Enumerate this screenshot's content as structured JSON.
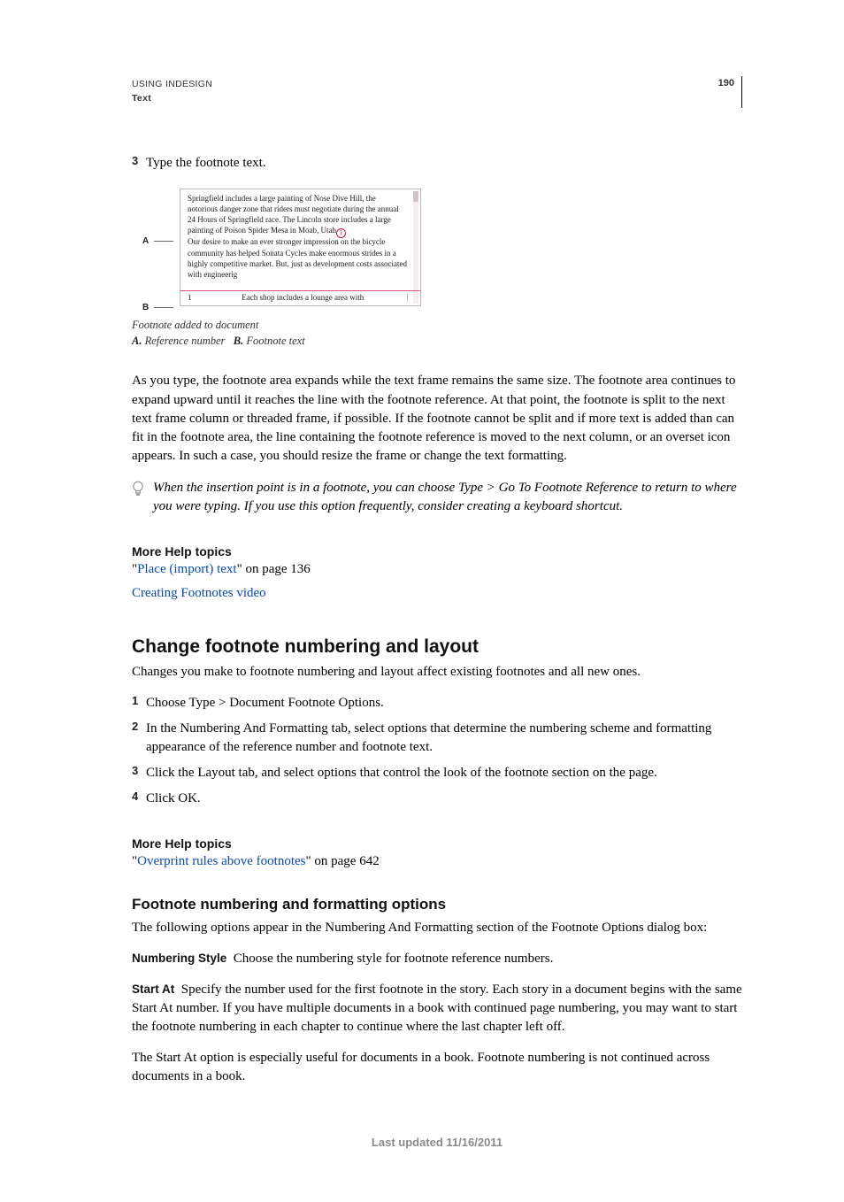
{
  "header": {
    "line1": "USING INDESIGN",
    "line2": "Text",
    "page_number": "190"
  },
  "step3": {
    "num": "3",
    "text": "Type the footnote text."
  },
  "figure": {
    "label_a": "A",
    "label_b": "B",
    "para1": "Springfield includes a large painting of Nose Dive Hill, the notorious danger zone that riders must negotiate during the annual 24 Hours of Springfield race. The Lincoln store includes a large painting of Poison Spider Mesa in Moab, Utah",
    "cursor_sup": "1",
    "para2": "Our desire to make an ever stronger impression on the bicycle community has helped Sonata Cycles make enormous strides in a highly competitive market. But, just as development costs associated with engineerig",
    "foot_num": "1",
    "foot_text": "Each shop includes a lounge area with",
    "caption_line1": "Footnote added to document",
    "caption_a_label": "A.",
    "caption_a_text": "Reference number",
    "caption_b_label": "B.",
    "caption_b_text": "Footnote text"
  },
  "body_para1": "As you type, the footnote area expands while the text frame remains the same size. The footnote area continues to expand upward until it reaches the line with the footnote reference. At that point, the footnote is split to the next text frame column or threaded frame, if possible. If the footnote cannot be split and if more text is added than can fit in the footnote area, the line containing the footnote reference is moved to the next column, or an overset icon appears. In such a case, you should resize the frame or change the text formatting.",
  "tip": "When the insertion point is in a footnote, you can choose Type > Go To Footnote Reference to return to where you were typing. If you use this option frequently, consider creating a keyboard shortcut.",
  "more_help_1": {
    "title": "More Help topics",
    "link1_text": "Place (import) text",
    "link1_suffix": "\" on page 136",
    "link1_prefix": "\"",
    "link2_text": "Creating Footnotes video"
  },
  "section2": {
    "heading": "Change footnote numbering and layout",
    "intro": "Changes you make to footnote numbering and layout affect existing footnotes and all new ones.",
    "steps": [
      {
        "n": "1",
        "t": "Choose Type > Document Footnote Options."
      },
      {
        "n": "2",
        "t": "In the Numbering And Formatting tab, select options that determine the numbering scheme and formatting appearance of the reference number and footnote text."
      },
      {
        "n": "3",
        "t": "Click the Layout tab, and select options that control the look of the footnote section on the page."
      },
      {
        "n": "4",
        "t": "Click OK."
      }
    ]
  },
  "more_help_2": {
    "title": "More Help topics",
    "link1_text": "Overprint rules above footnotes",
    "link1_prefix": "\"",
    "link1_suffix": "\" on page 642"
  },
  "section3": {
    "heading": "Footnote numbering and formatting options",
    "intro": "The following options appear in the Numbering And Formatting section of the Footnote Options dialog box:",
    "items": [
      {
        "label": "Numbering Style",
        "text": "Choose the numbering style for footnote reference numbers."
      },
      {
        "label": "Start At",
        "text": "Specify the number used for the first footnote in the story. Each story in a document begins with the same Start At number. If you have multiple documents in a book with continued page numbering, you may want to start the footnote numbering in each chapter to continue where the last chapter left off."
      }
    ],
    "after_para": "The Start At option is especially useful for documents in a book. Footnote numbering is not continued across documents in a book."
  },
  "footer": "Last updated 11/16/2011"
}
